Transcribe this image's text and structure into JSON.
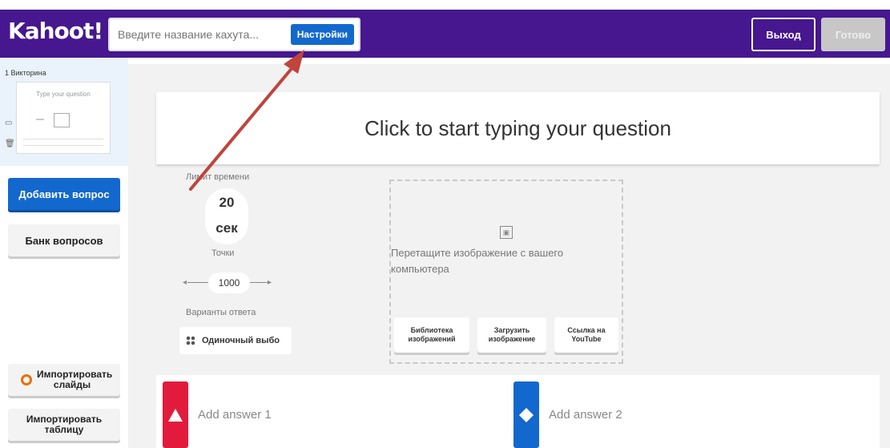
{
  "header": {
    "logo": "Kahoot!",
    "title_placeholder": "Введите название кахута...",
    "settings_label": "Настройки",
    "exit_label": "Выход",
    "done_label": "Готово"
  },
  "sidebar": {
    "slide_label": "1 Викторина",
    "thumb_question": "Type your question",
    "add_question": "Добавить вопрос",
    "question_bank": "Банк вопросов",
    "import_slides": "Импортировать слайды",
    "import_table": "Импортировать таблицу"
  },
  "question": {
    "placeholder": "Click to start typing your question"
  },
  "settings_panel": {
    "time_label": "Лимит времени",
    "time_value": "20",
    "time_unit": "сек",
    "points_label": "Точки",
    "points_value": "1000",
    "answers_label": "Варианты ответа",
    "answer_type": "Одиночный выбо"
  },
  "media": {
    "drop_text": "Перетащите изображение с вашего компьютера",
    "library_button": "Библиотека изображений",
    "upload_button": "Загрузить изображение",
    "youtube_button": "Ссылка на YouTube"
  },
  "answers": [
    {
      "placeholder": "Add answer 1",
      "color": "#e21b3c",
      "shape": "triangle"
    },
    {
      "placeholder": "Add answer 2",
      "color": "#1368ce",
      "shape": "diamond"
    }
  ],
  "colors": {
    "topbar": "#46178f",
    "primary_button": "#1368ce",
    "annotation_arrow": "#c0443c"
  }
}
